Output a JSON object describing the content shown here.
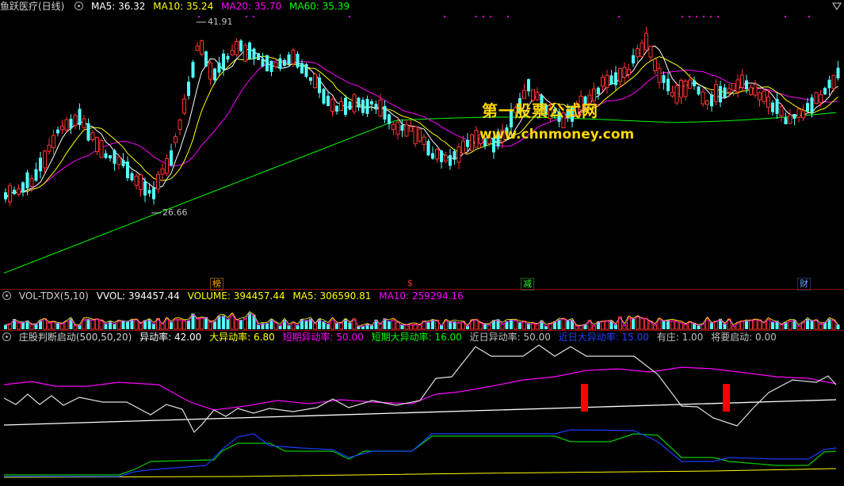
{
  "main": {
    "title": "鱼跃医疗(日线)",
    "ma5_label": "MA5: 36.32",
    "ma10_label": "MA10: 35.24",
    "ma20_label": "MA20: 35.70",
    "ma60_label": "MA60: 35.39",
    "high_label": "41.91",
    "low_label": "26.66",
    "events": [
      "榜",
      "$",
      "减",
      "财"
    ],
    "watermark_title": "第一股票公式网",
    "watermark_url": "www.chnmoney.com"
  },
  "volume": {
    "title": "VOL-TDX(5,10)",
    "vvol_label": "VVOL: 394457.44",
    "volume_label": "VOLUME: 394457.44",
    "ma5_label": "MA5: 306590.81",
    "ma10_label": "MA10: 259294.16"
  },
  "indicator": {
    "title": "庄股判断启动(500,50,20)",
    "v1": "异动率: 42.00",
    "v2": "大异动率: 6.80",
    "v3": "短期异动率: 50.00",
    "v4": "短期大异动率: 16.00",
    "v5": "近日异动率: 50.00",
    "v6": "近日大异动率: 15.00",
    "v7": "有庄: 1.00",
    "v8": "将要启动: 0.00"
  },
  "colors": {
    "up": "#ff3232",
    "down": "#54ffff",
    "ma5": "#ffffff",
    "ma10": "#ffff00",
    "ma20": "#ff00ff",
    "ma60": "#00ff00",
    "separator": "#8b0000"
  }
}
